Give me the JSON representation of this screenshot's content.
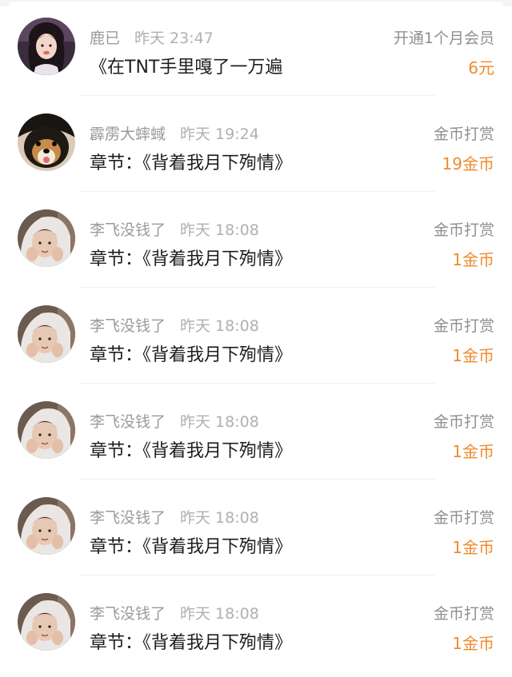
{
  "items": [
    {
      "avatar": "girl-avatar",
      "name": "鹿已",
      "time": "昨天 23:47",
      "title": "《在TNT手里嘎了一万遍",
      "action": "开通1个月会员",
      "amount": "6元"
    },
    {
      "avatar": "dog-avatar",
      "name": "霹雳大蟀蜮",
      "time": "昨天 19:24",
      "title": "章节：《背着我月下殉情》",
      "action": "金币打赏",
      "amount": "19金币"
    },
    {
      "avatar": "hooded-boy-avatar",
      "name": "李飞没钱了",
      "time": "昨天 18:08",
      "title": "章节：《背着我月下殉情》",
      "action": "金币打赏",
      "amount": "1金币"
    },
    {
      "avatar": "hooded-boy-avatar",
      "name": "李飞没钱了",
      "time": "昨天 18:08",
      "title": "章节：《背着我月下殉情》",
      "action": "金币打赏",
      "amount": "1金币"
    },
    {
      "avatar": "hooded-boy-avatar",
      "name": "李飞没钱了",
      "time": "昨天 18:08",
      "title": "章节：《背着我月下殉情》",
      "action": "金币打赏",
      "amount": "1金币"
    },
    {
      "avatar": "hooded-boy-avatar",
      "name": "李飞没钱了",
      "time": "昨天 18:08",
      "title": "章节：《背着我月下殉情》",
      "action": "金币打赏",
      "amount": "1金币"
    },
    {
      "avatar": "hooded-boy-avatar",
      "name": "李飞没钱了",
      "time": "昨天 18:08",
      "title": "章节：《背着我月下殉情》",
      "action": "金币打赏",
      "amount": "1金币"
    }
  ],
  "colors": {
    "amount": "#f08a2c",
    "name": "#9a9a9a",
    "title": "#1e1e1e"
  }
}
